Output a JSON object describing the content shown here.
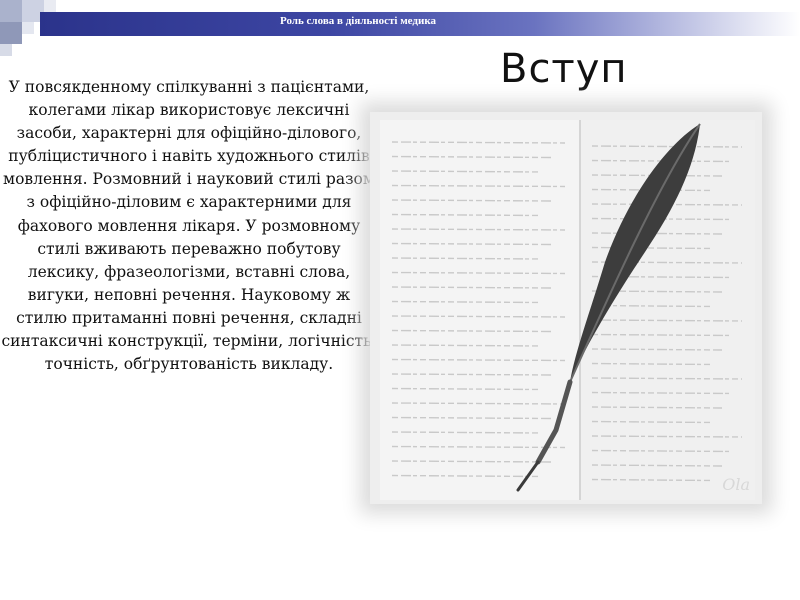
{
  "header": {
    "title": "Роль слова в діяльності медика"
  },
  "slide": {
    "title": "Вступ",
    "body": "У повсякденному спілкуванні з пацієнтами, колегами лікар використовує лексичні засоби, характерні для офіційно-ділового, публіцистичного і навіть художнього стилів мовлення. Розмовний і науковий стилі разом з офіційно-діловим є характерними для фахового мовлення лікаря. У розмовному стилі вживають переважно побутову лексику, фразеологізми, вставні слова, вигуки, неповні речення. Науковому ж стилю притаманні повні речення, складні синтаксичні конструкції, терміни, логічність, точність, обґрунтованість викладу."
  },
  "picture": {
    "signature": "Ola",
    "icons": [
      "quill-pen-icon",
      "manuscript-image"
    ]
  },
  "colors": {
    "header_dark": "#2b338b",
    "header_mid": "#3d46a3",
    "text": "#111111"
  }
}
